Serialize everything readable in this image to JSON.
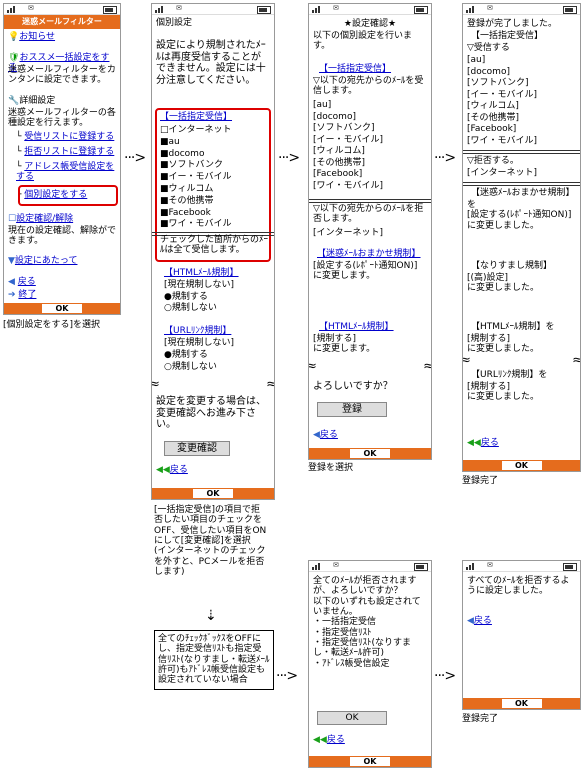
{
  "screen1": {
    "title": "迷惑メールフィルター",
    "news": "お知らせ",
    "recommend": "おススメ一括設定をする",
    "recommend_desc": "迷惑メールフィルターをカンタンに設定できます。",
    "detail_head": "詳細設定",
    "detail_desc": "迷惑メールフィルターの各種設定を行えます。",
    "items": [
      "受信リストに登録する",
      "拒否リストに登録する",
      "アドレス帳受信設定をする",
      "個別設定をする"
    ],
    "confirm": "設定確認/解除",
    "confirm_desc": "現在の設定確認、解除ができます。",
    "about": "設定にあたって",
    "back": "戻る",
    "end": "終了",
    "ok": "OK",
    "caption": "[個別設定をする]を選択"
  },
  "screen2": {
    "title": "個別設定",
    "intro": "設定により規制されたﾒｰﾙは再度受信することができません。設定には十分注意してください。",
    "bulk_head": "【一括指定受信】",
    "checks": [
      "□インターネット",
      "■au",
      "■docomo",
      "■ソフトバンク",
      "■イー・モバイル",
      "■ウィルコム",
      "■その他携帯",
      "■Facebook",
      "■ワイ・モバイル"
    ],
    "bulk_note": "チェックした箇所からのﾒｰﾙは全て受信します。",
    "html_head": "【HTMLﾒｰﾙ規制】",
    "html_desc": "[現在規制しない]",
    "html_opts": [
      "●規制する",
      "○規制しない"
    ],
    "url_head": "【URLﾘﾝｸ規制】",
    "url_desc": "[現在規制しない]",
    "url_opts": [
      "●規制する",
      "○規制しない"
    ],
    "change_note": "設定を変更する場合は、変更確認へお進み下さい。",
    "change_btn": "変更確認",
    "back": "戻る",
    "ok": "OK",
    "caption": "[一括指定受信]の項目で拒否したい項目のチェックをOFF、受信したい項目をONにして[変更確認]を選択\n(インターネットのチェックを外すと、PCメールを拒否します)",
    "note": "全てのﾁｪｯｸﾎﾞｯｸｽをOFFにし、指定受信ﾘｽﾄも指定受信ﾘｽﾄ(なりすまし・転送ﾒｰﾙ許可)もｱﾄﾞﾚｽ帳受信設定も設定されていない場合"
  },
  "screen3": {
    "title": "★設定確認★",
    "intro": "以下の個別設定を行います。",
    "bulk_head": "【一括指定受信】",
    "recv_intro": "▽以下の宛先からのﾒｰﾙを受信します。",
    "recv_list": [
      "[au]",
      "[docomo]",
      "[ソフトバンク]",
      "[イー・モバイル]",
      "[ウィルコム]",
      "[その他携帯]",
      "[Facebook]",
      "[ワイ・モバイル]"
    ],
    "reject_intro": "▽以下の宛先からのﾒｰﾙを拒否します。",
    "reject_list": [
      "[インターネット]"
    ],
    "omakase_head": "【迷惑ﾒｰﾙおまかせ規制】",
    "omakase_desc": "[設定する(ﾚﾎﾟｰﾄ通知ON)]\nに変更します。",
    "html_head": "【HTMLﾒｰﾙ規制】",
    "html_desc": "[規制する]\nに変更します。",
    "question": "よろしいですか？",
    "register_btn": "登録",
    "back": "戻る",
    "ok": "OK",
    "caption": "登録を選択"
  },
  "screen4": {
    "intro": "登録が完了しました。",
    "bulk_head": "【一括指定受信】",
    "recv_intro": "▽受信する",
    "recv_list": [
      "[au]",
      "[docomo]",
      "[ソフトバンク]",
      "[イー・モバイル]",
      "[ウィルコム]",
      "[その他携帯]",
      "[Facebook]",
      "[ワイ・モバイル]"
    ],
    "reject_intro": "▽拒否する。",
    "reject_list": [
      "[インターネット]"
    ],
    "omakase_head": "【迷惑ﾒｰﾙおまかせ規制】",
    "omakase_desc": "を\n[設定する(ﾚﾎﾟｰﾄ通知ON)]\nに変更しました。",
    "spoof_head": "【なりすまし規制】",
    "spoof_desc": "[(高)設定]\nに変更しました。",
    "html_head": "【HTMLﾒｰﾙ規制】を",
    "html_desc": "[規制する]\nに変更しました。",
    "url_head": "【URLﾘﾝｸ規制】を",
    "url_desc": "[規制する]\nに変更しました。",
    "back": "戻る",
    "ok": "OK",
    "caption": "登録完了"
  },
  "screen5": {
    "text": "全てのﾒｰﾙが拒否されますが、よろしいですか？\n以下のいずれも設定されていません。\n・一括指定受信\n・指定受信ﾘｽﾄ\n・指定受信ﾘｽﾄ(なりすまし・転送ﾒｰﾙ許可)\n・ｱﾄﾞﾚｽ帳受信設定",
    "ok_btn": "OK",
    "back": "戻る",
    "ok": "OK"
  },
  "screen6": {
    "text": "すべてのﾒｰﾙを拒否するように設定しました。",
    "back": "戻る",
    "ok": "OK",
    "caption": "登録完了"
  },
  "status_icons": [
    "signal-icon",
    "mail-icon",
    "battery-icon"
  ]
}
